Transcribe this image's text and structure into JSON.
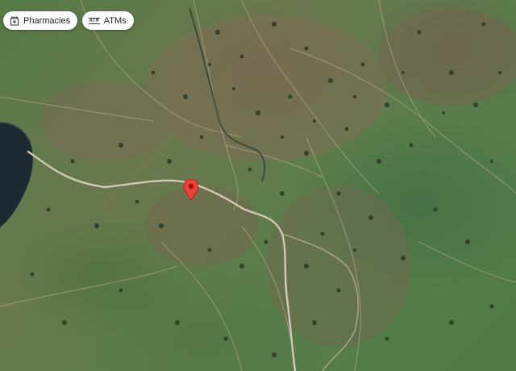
{
  "map": {
    "view": "satellite",
    "marker": {
      "icon": "location-pin-icon",
      "color": "#ea4335"
    }
  },
  "filters": {
    "chips": [
      {
        "label": "Pharmacies",
        "icon": "pharmacy-icon"
      },
      {
        "label": "ATMs",
        "icon": "atm-icon"
      }
    ]
  },
  "colors": {
    "terrain_green": "#557a45",
    "terrain_brown": "#7a6a52",
    "track": "#c9bfae",
    "water": "#1d2a33",
    "marker": "#ea4335"
  }
}
